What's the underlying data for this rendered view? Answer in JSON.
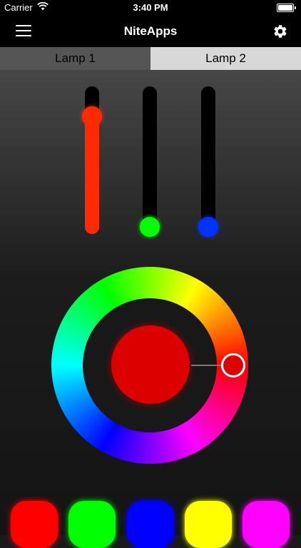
{
  "status_bar": {
    "carrier": "Carrier",
    "time": "3:40 PM"
  },
  "nav": {
    "title": "NiteApps"
  },
  "tabs": [
    {
      "label": "Lamp 1",
      "active": true
    },
    {
      "label": "Lamp 2",
      "active": false
    }
  ],
  "sliders": [
    {
      "channel": "red",
      "color": "#ff2a00",
      "value": 0.83
    },
    {
      "channel": "green",
      "color": "#00ff00",
      "value": 0.0
    },
    {
      "channel": "blue",
      "color": "#0033ff",
      "value": 0.0
    }
  ],
  "current_color": "#dd0000",
  "presets": [
    {
      "color": "#ff0000"
    },
    {
      "color": "#00ff00"
    },
    {
      "color": "#0000ff"
    },
    {
      "color": "#ffff00"
    },
    {
      "color": "#ff00ff"
    }
  ],
  "icons": [
    "wifi-icon",
    "battery-icon",
    "menu-icon",
    "gear-icon"
  ]
}
